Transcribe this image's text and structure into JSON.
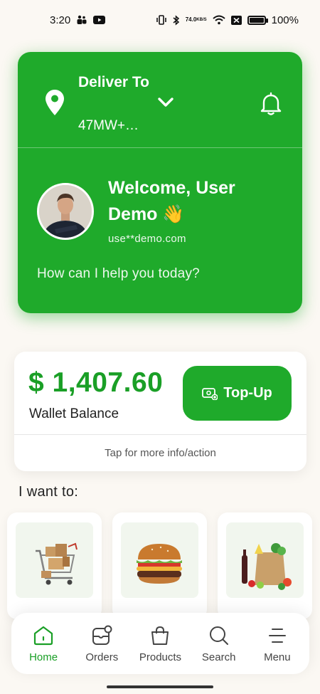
{
  "status_bar": {
    "time": "3:20",
    "net_speed_value": "74.0",
    "net_speed_unit": "KB/S",
    "battery_percent": "100%",
    "battery_level": 1.0
  },
  "header": {
    "deliver_label": "Deliver To",
    "address": "47MW+…",
    "welcome": "Welcome, User Demo 👋",
    "email": "use**demo.com",
    "help_prompt": "How can I help you today?"
  },
  "wallet": {
    "amount": "$ 1,407.60",
    "label": "Wallet Balance",
    "topup_label": "Top-Up",
    "info_text": "Tap for more info/action"
  },
  "section": {
    "title": "I want to:"
  },
  "actions": [
    {
      "icon": "shopping-cart-icon"
    },
    {
      "icon": "burger-icon"
    },
    {
      "icon": "grocery-bag-icon"
    }
  ],
  "nav": {
    "items": [
      {
        "label": "Home",
        "icon": "home-icon",
        "active": true
      },
      {
        "label": "Orders",
        "icon": "orders-icon"
      },
      {
        "label": "Products",
        "icon": "shopping-bag-icon"
      },
      {
        "label": "Search",
        "icon": "search-icon"
      },
      {
        "label": "Menu",
        "icon": "menu-icon"
      }
    ]
  },
  "colors": {
    "brand": "#1faa2b",
    "brand_text": "#1a9f26"
  }
}
